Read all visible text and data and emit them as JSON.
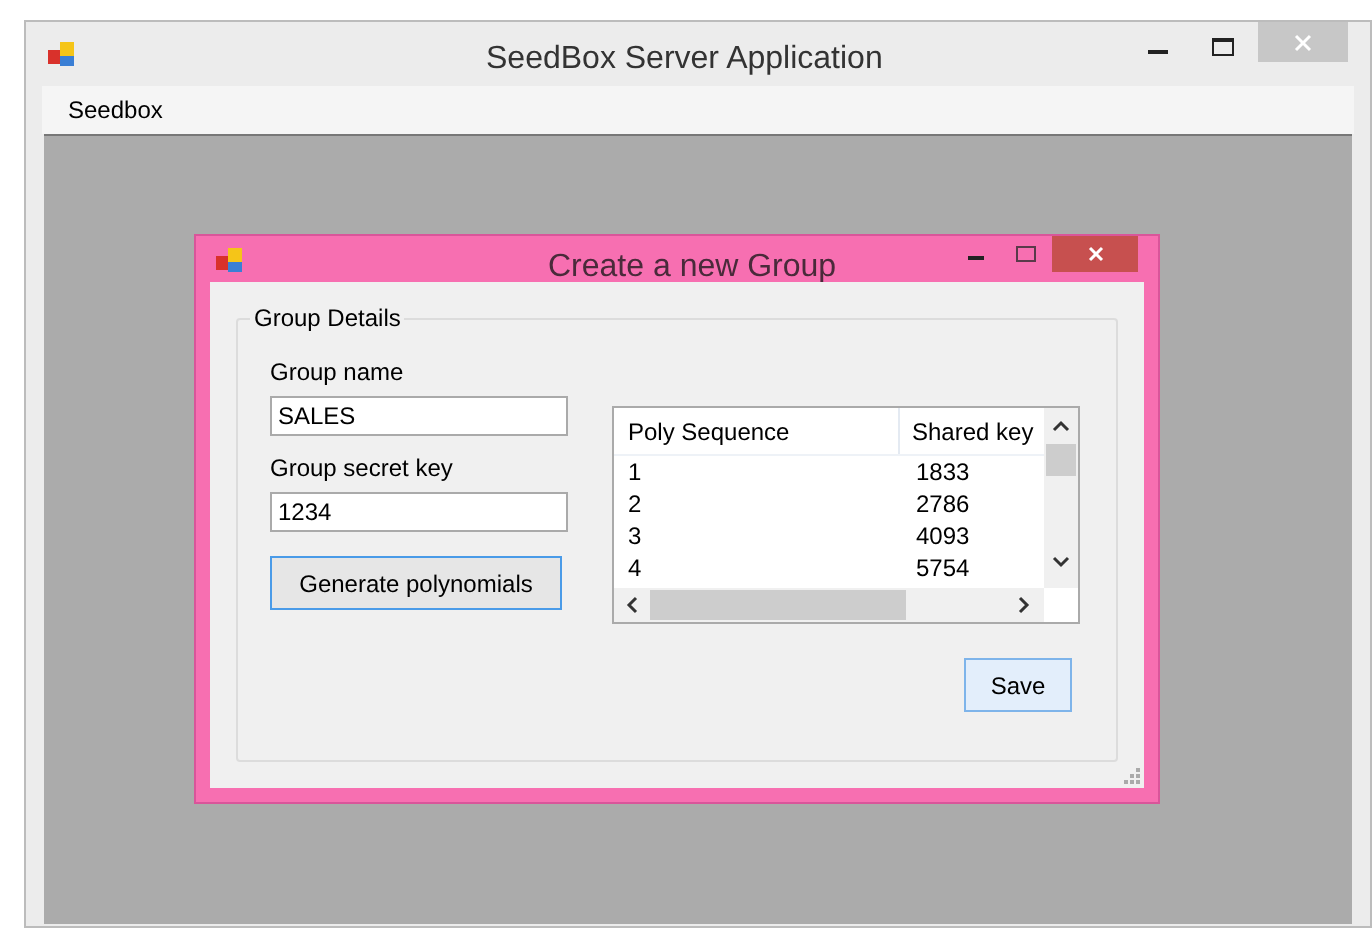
{
  "window": {
    "title": "SeedBox Server Application"
  },
  "menu": [
    "Seedbox"
  ],
  "dialog": {
    "title": "Create a new Group",
    "group_box": {
      "title": "Group Details",
      "fields": [
        {
          "label": "Group name",
          "value": "SALES"
        },
        {
          "label": "Group secret key",
          "value": "1234"
        }
      ],
      "generate_button": "Generate polynomials",
      "table": {
        "columns": [
          "Poly Sequence",
          "Shared key"
        ],
        "rows": [
          [
            "1",
            "1833"
          ],
          [
            "2",
            "2786"
          ],
          [
            "3",
            "4093"
          ],
          [
            "4",
            "5754"
          ]
        ]
      },
      "save_button": "Save"
    }
  }
}
